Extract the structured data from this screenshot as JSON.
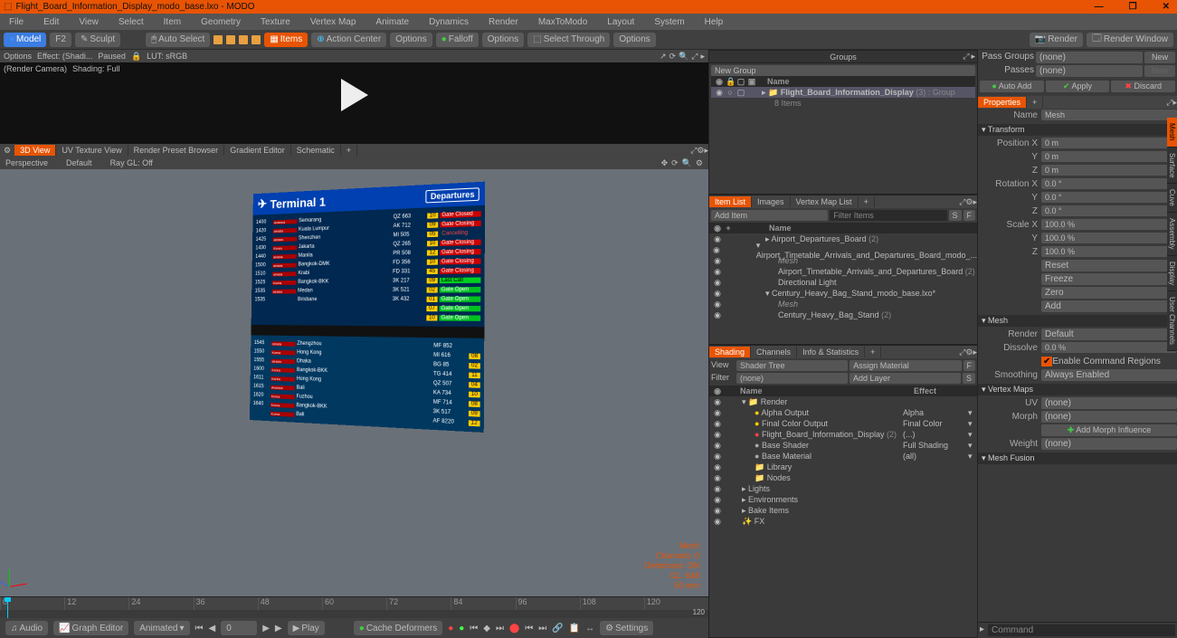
{
  "title": "Flight_Board_Information_Display_modo_base.lxo - MODO",
  "menu": [
    "File",
    "Edit",
    "View",
    "Select",
    "Item",
    "Geometry",
    "Texture",
    "Vertex Map",
    "Animate",
    "Dynamics",
    "Render",
    "MaxToModo",
    "Layout",
    "System",
    "Help"
  ],
  "toolbar": {
    "model": "Model",
    "f2": "F2",
    "sculpt": "Sculpt",
    "autoselect": "Auto Select",
    "items": "Items",
    "action_center": "Action Center",
    "options1": "Options",
    "falloff": "Falloff",
    "options2": "Options",
    "select_through": "Select Through",
    "options3": "Options",
    "render": "Render",
    "render_window": "Render Window"
  },
  "preview_bar": {
    "options": "Options",
    "effect": "Effect: (Shadi...",
    "paused": "Paused",
    "lut": "LUT: sRGB",
    "render_camera": "(Render Camera)",
    "shading": "Shading: Full"
  },
  "viewport_tabs": [
    "3D View",
    "UV Texture View",
    "Render Preset Browser",
    "Gradient Editor",
    "Schematic"
  ],
  "viewport_bar": {
    "perspective": "Perspective",
    "default": "Default",
    "raygl": "Ray GL: Off"
  },
  "board": {
    "terminal": "Terminal 1",
    "departures": "Departures",
    "rows_top": [
      {
        "time": "1400",
        "airline": "Avianca",
        "dest": "Semarang",
        "flight": "QZ 663",
        "gate": "10",
        "status": "Gate Closed",
        "cls": "closed"
      },
      {
        "time": "1420",
        "airline": "airasia",
        "dest": "Kuala Lumpur",
        "flight": "AK 712",
        "gate": "09",
        "status": "Gate Closing",
        "cls": "closing"
      },
      {
        "time": "1425",
        "airline": "airasia",
        "dest": "Shenzhen",
        "flight": "MI 505",
        "gate": "05",
        "status": "Cancelling",
        "cls": "cancelling"
      },
      {
        "time": "1430",
        "airline": "Korea",
        "dest": "Jakarta",
        "flight": "QZ 265",
        "gate": "10",
        "status": "Gate Closing",
        "cls": "closing"
      },
      {
        "time": "1440",
        "airline": "airasia",
        "dest": "Manila",
        "flight": "PR 508",
        "gate": "12",
        "status": "Gate Closing",
        "cls": "closing"
      },
      {
        "time": "1500",
        "airline": "airasia",
        "dest": "Bangkok-DMK",
        "flight": "FD 356",
        "gate": "10",
        "status": "Gate Closing",
        "cls": "closing"
      },
      {
        "time": "1510",
        "airline": "airasia",
        "dest": "Krabi",
        "flight": "FD 331",
        "gate": "45",
        "status": "Gate Closing",
        "cls": "closing"
      },
      {
        "time": "1525",
        "airline": "Korea",
        "dest": "Bangkok-BKK",
        "flight": "3K 217",
        "gate": "09",
        "status": "Last Call",
        "cls": "lastcall"
      },
      {
        "time": "1535",
        "airline": "airasia",
        "dest": "Medan",
        "flight": "3K 521",
        "gate": "02",
        "status": "Gate Open",
        "cls": "open"
      },
      {
        "time": "1535",
        "airline": "",
        "dest": "Brisbane",
        "flight": "3K 432",
        "gate": "01",
        "status": "Gate Open",
        "cls": "open"
      },
      {
        "time": "",
        "airline": "",
        "dest": "",
        "flight": "",
        "gate": "07",
        "status": "Gate Open",
        "cls": "open"
      },
      {
        "time": "",
        "airline": "",
        "dest": "",
        "flight": "",
        "gate": "10",
        "status": "Gate Open",
        "cls": "open"
      }
    ],
    "rows_bot": [
      {
        "time": "1545",
        "airline": "airasia",
        "dest": "Zhengzhou",
        "flight": "MF 852",
        "gate": ""
      },
      {
        "time": "1550",
        "airline": "Korea",
        "dest": "Hong Kong",
        "flight": "MI 616",
        "gate": "08"
      },
      {
        "time": "1555",
        "airline": "airasia",
        "dest": "Dhaka",
        "flight": "BG 85",
        "gate": "02"
      },
      {
        "time": "1600",
        "airline": "Korea",
        "dest": "Bangkok-BKK",
        "flight": "TG 414",
        "gate": "11"
      },
      {
        "time": "1611",
        "airline": "Korea",
        "dest": "Hong Kong",
        "flight": "QZ 507",
        "gate": "04"
      },
      {
        "time": "1615",
        "airline": "Avianca",
        "dest": "Bali",
        "flight": "KA 734",
        "gate": "10"
      },
      {
        "time": "1620",
        "airline": "Korea",
        "dest": "Fuzhou",
        "flight": "MF 714",
        "gate": "08"
      },
      {
        "time": "1640",
        "airline": "Korea",
        "dest": "Bangkok-BKK",
        "flight": "3K 517",
        "gate": "09"
      },
      {
        "time": "",
        "airline": "Korea",
        "dest": "Bali",
        "flight": "AF 8220",
        "gate": "12"
      }
    ]
  },
  "viewport_info": {
    "type": "Mesh",
    "channels": "Channels: 0",
    "deformers": "Deformers: ON",
    "gl": "GL: 648",
    "lens": "50 mm"
  },
  "timeline_ticks": [
    "0",
    "12",
    "24",
    "36",
    "48",
    "60",
    "72",
    "84",
    "96",
    "108",
    "120"
  ],
  "timeline_end": "120",
  "bottom": {
    "audio": "Audio",
    "graph": "Graph Editor",
    "animated": "Animated",
    "frame": "0",
    "play": "Play",
    "cache": "Cache Deformers",
    "settings": "Settings"
  },
  "groups": {
    "title": "Groups",
    "new_group": "New Group",
    "col": "Name",
    "item": "Flight_Board_Information_Display",
    "item_suffix": "(3) : Group",
    "count": "8 Items"
  },
  "item_list": {
    "tabs": [
      "Item List",
      "Images",
      "Vertex Map List"
    ],
    "add_item": "Add Item",
    "filter": "Filter Items",
    "col": "Name",
    "items": [
      {
        "name": "Airport_Departures_Board",
        "suffix": "(2)",
        "indent": 1
      },
      {
        "name": "Airport_Timetable_Arrivals_and_Departures_Board_modo_...",
        "suffix": "",
        "indent": 1,
        "expanded": true
      },
      {
        "name": "Mesh",
        "suffix": "",
        "indent": 2,
        "italic": true
      },
      {
        "name": "Airport_Timetable_Arrivals_and_Departures_Board",
        "suffix": "(2)",
        "indent": 2
      },
      {
        "name": "Directional Light",
        "suffix": "",
        "indent": 2
      },
      {
        "name": "Century_Heavy_Bag_Stand_modo_base.lxo*",
        "suffix": "",
        "indent": 1,
        "expanded": true
      },
      {
        "name": "Mesh",
        "suffix": "",
        "indent": 2,
        "italic": true
      },
      {
        "name": "Century_Heavy_Bag_Stand",
        "suffix": "(2)",
        "indent": 2
      }
    ]
  },
  "shading": {
    "tabs": [
      "Shading",
      "Channels",
      "Info & Statistics"
    ],
    "view": "View",
    "shader_tree": "Shader Tree",
    "assign": "Assign Material",
    "filter": "Filter",
    "none": "(none)",
    "add_layer": "Add Layer",
    "cols": {
      "name": "Name",
      "effect": "Effect"
    },
    "rows": [
      {
        "name": "Render",
        "effect": "",
        "icon": "folder"
      },
      {
        "name": "Alpha Output",
        "effect": "Alpha",
        "icon": "circle"
      },
      {
        "name": "Final Color Output",
        "effect": "Final Color",
        "icon": "circle"
      },
      {
        "name": "Flight_Board_Information_Display",
        "effect": "(...)",
        "suffix": "(2)",
        "icon": "red"
      },
      {
        "name": "Base Shader",
        "effect": "Full Shading",
        "icon": "gray"
      },
      {
        "name": "Base Material",
        "effect": "(all)",
        "icon": "gray"
      },
      {
        "name": "Library",
        "effect": "",
        "icon": "folder"
      },
      {
        "name": "Nodes",
        "effect": "",
        "icon": "folder"
      },
      {
        "name": "Lights",
        "effect": ""
      },
      {
        "name": "Environments",
        "effect": ""
      },
      {
        "name": "Bake Items",
        "effect": ""
      },
      {
        "name": "FX",
        "effect": "",
        "icon": "fx"
      }
    ]
  },
  "props": {
    "pass_groups": "Pass Groups",
    "none": "(none)",
    "new": "New",
    "passes": "Passes",
    "auto_add": "Auto Add",
    "apply": "Apply",
    "discard": "Discard",
    "properties": "Properties",
    "name_label": "Name",
    "name_value": "Mesh",
    "transform": "Transform",
    "position": {
      "x": "0 m",
      "y": "0 m",
      "z": "0 m"
    },
    "rotation": {
      "x": "0.0 °",
      "y": "0.0 °",
      "z": "0.0 °"
    },
    "scale": {
      "x": "100.0 %",
      "y": "100.0 %",
      "z": "100.0 %"
    },
    "reset": "Reset",
    "freeze": "Freeze",
    "zero": "Zero",
    "add": "Add",
    "mesh_section": "Mesh",
    "render_label": "Render",
    "render_value": "Default",
    "dissolve_label": "Dissolve",
    "dissolve_value": "0.0 %",
    "enable_cmd": "Enable Command Regions",
    "smoothing_label": "Smoothing",
    "smoothing_value": "Always Enabled",
    "vertex_maps": "Vertex Maps",
    "uv": "UV",
    "morph": "Morph",
    "weight": "Weight",
    "add_morph": "Add Morph Influence",
    "mesh_fusion": "Mesh Fusion",
    "command": "Command"
  },
  "side_tabs": [
    "Mesh",
    "Surface",
    "Cuve",
    "Assembly",
    "Display",
    "User Channels"
  ]
}
